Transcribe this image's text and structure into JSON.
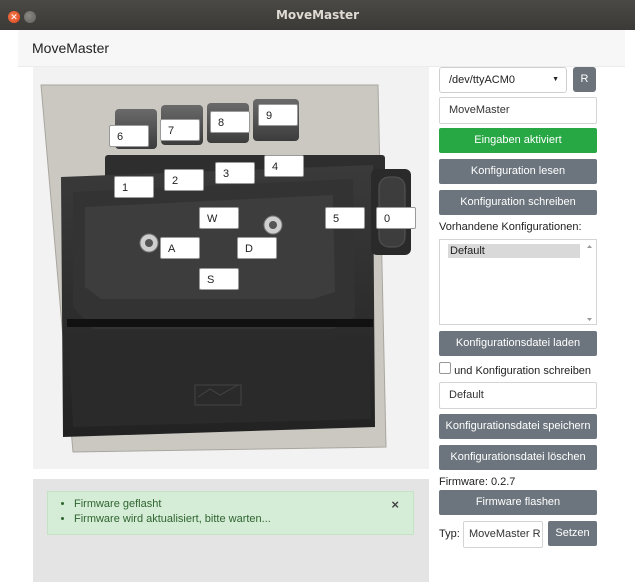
{
  "window": {
    "title": "MoveMaster"
  },
  "app": {
    "header": "MoveMaster"
  },
  "keys": {
    "k6": "6",
    "k7": "7",
    "k8": "8",
    "k9": "9",
    "k1": "1",
    "k2": "2",
    "k3": "3",
    "k4": "4",
    "kW": "W",
    "kA": "A",
    "kD": "D",
    "kS": "S",
    "k5": "5",
    "k0": "0"
  },
  "messages": {
    "items": [
      "Firmware geflasht",
      "Firmware wird aktualisiert, bitte warten..."
    ],
    "close": "×"
  },
  "controls": {
    "port_select": "/dev/ttyACM0",
    "refresh_label": "R",
    "device_name": "MoveMaster",
    "inputs_active": "Eingaben aktiviert",
    "read_config": "Konfiguration lesen",
    "write_config": "Konfiguration schreiben",
    "existing_configs_label": "Vorhandene Konfigurationen:",
    "config_list": [
      "Default"
    ],
    "load_file": "Konfigurationsdatei laden",
    "also_write_label": "und Konfiguration schreiben",
    "config_name": "Default",
    "save_file": "Konfigurationsdatei speichern",
    "delete_file": "Konfigurationsdatei löschen",
    "firmware_label": "Firmware: 0.2.7",
    "flash_firmware": "Firmware flashen",
    "type_label": "Typ:",
    "type_value": "MoveMaster R",
    "set_label": "Setzen"
  }
}
